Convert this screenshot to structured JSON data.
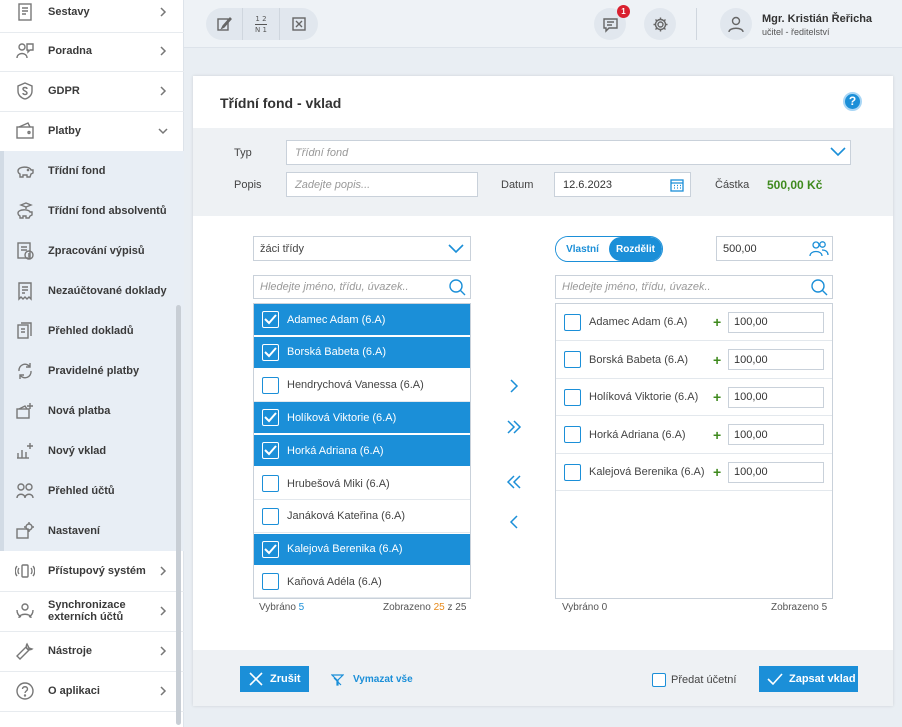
{
  "sidebar": {
    "items": [
      {
        "label": "Sestavy",
        "icon": "report-icon",
        "chevron": "right",
        "sub": false
      },
      {
        "label": "Poradna",
        "icon": "counseling-icon",
        "chevron": "right",
        "sub": false
      },
      {
        "label": "GDPR",
        "icon": "shield-icon",
        "chevron": "right",
        "sub": false
      },
      {
        "label": "Platby",
        "icon": "wallet-icon",
        "chevron": "down",
        "sub": false
      },
      {
        "label": "Třídní fond",
        "icon": "piggy-bank-icon",
        "chevron": "",
        "sub": true
      },
      {
        "label": "Třídní fond absolventů",
        "icon": "graduate-piggy-icon",
        "chevron": "",
        "sub": true
      },
      {
        "label": "Zpracování výpisů",
        "icon": "statement-icon",
        "chevron": "",
        "sub": true
      },
      {
        "label": "Nezaúčtované doklady",
        "icon": "receipt-icon",
        "chevron": "",
        "sub": true
      },
      {
        "label": "Přehled dokladů",
        "icon": "documents-icon",
        "chevron": "",
        "sub": true
      },
      {
        "label": "Pravidelné platby",
        "icon": "recurring-icon",
        "chevron": "",
        "sub": true
      },
      {
        "label": "Nová platba",
        "icon": "new-payment-icon",
        "chevron": "",
        "sub": true
      },
      {
        "label": "Nový vklad",
        "icon": "new-deposit-icon",
        "chevron": "",
        "sub": true
      },
      {
        "label": "Přehled účtů",
        "icon": "accounts-icon",
        "chevron": "",
        "sub": true
      },
      {
        "label": "Nastavení",
        "icon": "settings-icon",
        "chevron": "",
        "sub": true
      },
      {
        "label": "Přístupový systém",
        "icon": "access-icon",
        "chevron": "right",
        "sub": false
      },
      {
        "label": "Synchronizace externích účtů",
        "icon": "sync-icon",
        "chevron": "right",
        "sub": false
      },
      {
        "label": "Nástroje",
        "icon": "wrench-icon",
        "chevron": "right",
        "sub": false
      },
      {
        "label": "O aplikaci",
        "icon": "question-icon",
        "chevron": "right",
        "sub": false
      }
    ]
  },
  "topbar": {
    "tool2_top": "1 2",
    "tool2_bottom": "N 1",
    "notification_count": "1",
    "user_name": "Mgr. Kristián Řeřicha",
    "user_role": "učitel - ředitelství"
  },
  "panel": {
    "title": "Třídní fond - vklad",
    "help": "?",
    "form": {
      "type_label": "Typ",
      "type_placeholder": "Třídní fond",
      "desc_label": "Popis",
      "desc_placeholder": "Zadejte popis...",
      "date_label": "Datum",
      "date_value": "12.6.2023",
      "amount_label": "Částka",
      "amount_value": "500,00 Kč"
    },
    "left": {
      "dropdown": "žáci třídy",
      "search_placeholder": "Hledejte jméno, třídu, úvazek..",
      "rows": [
        {
          "name": "Adamec Adam (6.A)",
          "selected": true
        },
        {
          "name": "Borská Babeta (6.A)",
          "selected": true
        },
        {
          "name": "Hendrychová Vanessa (6.A)",
          "selected": false
        },
        {
          "name": "Holíková Viktorie (6.A)",
          "selected": true
        },
        {
          "name": "Horká Adriana (6.A)",
          "selected": true
        },
        {
          "name": "Hrubešová Miki (6.A)",
          "selected": false
        },
        {
          "name": "Janáková Kateřina (6.A)",
          "selected": false
        },
        {
          "name": "Kalejová Berenika (6.A)",
          "selected": true
        },
        {
          "name": "Kaňová Adéla (6.A)",
          "selected": false
        }
      ],
      "selected_label": "Vybráno",
      "selected_count": "5",
      "shown_label": "Zobrazeno",
      "shown_count": "25",
      "shown_of": "z 25"
    },
    "right": {
      "toggle_off": "Vlastní",
      "toggle_on": "Rozdělit",
      "total_value": "500,00",
      "search_placeholder": "Hledejte jméno, třídu, úvazek..",
      "rows": [
        {
          "name": "Adamec Adam (6.A)",
          "amount": "100,00"
        },
        {
          "name": "Borská Babeta (6.A)",
          "amount": "100,00"
        },
        {
          "name": "Holíková Viktorie (6.A)",
          "amount": "100,00"
        },
        {
          "name": "Horká Adriana (6.A)",
          "amount": "100,00"
        },
        {
          "name": "Kalejová Berenika (6.A)",
          "amount": "100,00"
        }
      ],
      "selected_text": "Vybráno 0",
      "shown_text": "Zobrazeno 5"
    },
    "bottom": {
      "cancel": "Zrušit",
      "clear_all": "Vymazat vše",
      "pass_to_accountant": "Předat účetní",
      "submit": "Zapsat vklad"
    }
  }
}
